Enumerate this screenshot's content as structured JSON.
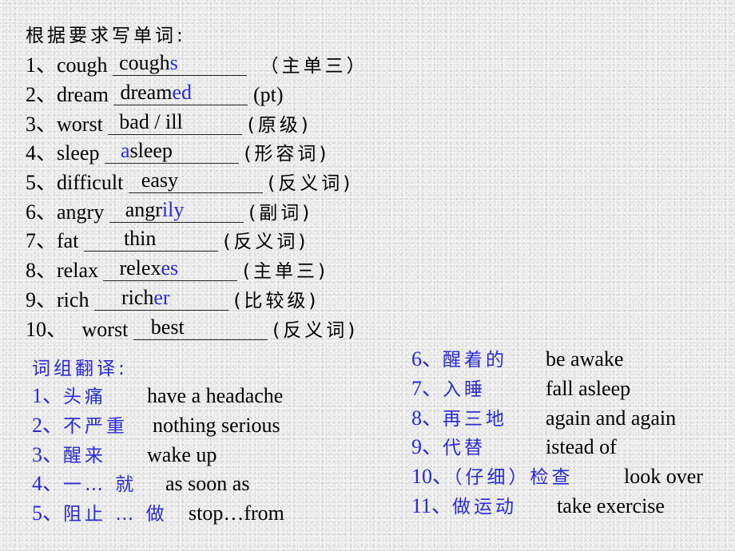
{
  "header": "根据要求写单词:",
  "exercises": [
    {
      "num": "1、",
      "word": "cough",
      "answer_base": "cough",
      "answer_suffix": "s",
      "note": "（主单三）"
    },
    {
      "num": "2、",
      "word": "dream",
      "answer_base": "dream",
      "answer_suffix": "ed",
      "note": "(pt)"
    },
    {
      "num": "3、",
      "word": "worst",
      "answer_base": "bad / ill",
      "answer_suffix": "",
      "note": "(原级)"
    },
    {
      "num": "4、",
      "word": "sleep",
      "answer_prefix": "a",
      "answer_base": "sleep",
      "answer_suffix": "",
      "note": "(形容词)"
    },
    {
      "num": "5、",
      "word": "difficult",
      "answer_base": "easy",
      "answer_suffix": "",
      "note": "(反义词)"
    },
    {
      "num": "6、",
      "word": "angry",
      "answer_base": "angr",
      "answer_suffix": "ily",
      "note": "(副词)"
    },
    {
      "num": "7、",
      "word": "fat",
      "answer_base": "thin",
      "answer_suffix": "",
      "note": "(反义词)"
    },
    {
      "num": "8、",
      "word": "relax",
      "answer_base": "relex",
      "answer_suffix": "es",
      "note": "(主单三)"
    },
    {
      "num": "9、",
      "word": "rich",
      "answer_base": "rich",
      "answer_suffix": "er",
      "note": "(比较级)"
    },
    {
      "num": "10、",
      "word": " worst",
      "answer_base": "best",
      "answer_suffix": "",
      "note": "(反义词)"
    }
  ],
  "phrases_header": "词组翻译:",
  "phrases_left": [
    {
      "num": "1、",
      "cn": "头痛",
      "en": "have a headache"
    },
    {
      "num": "2、",
      "cn": "不严重",
      "en": "nothing serious"
    },
    {
      "num": "3、",
      "cn": "醒来",
      "en": "wake up"
    },
    {
      "num": "4、",
      "cn": "一… 就",
      "en": "as soon as"
    },
    {
      "num": "5、",
      "cn": "阻止 … 做",
      "en": "stop…from"
    }
  ],
  "phrases_right": [
    {
      "num": "6、",
      "cn": "醒着的",
      "en": "be awake"
    },
    {
      "num": "7、",
      "cn": "入睡",
      "en": "fall asleep"
    },
    {
      "num": "8、",
      "cn": "再三地",
      "en": "again and again"
    },
    {
      "num": "9、",
      "cn": "代替",
      "en": "istead of"
    },
    {
      "num": "10、",
      "cn": "（仔细）检查",
      "en": "look over"
    },
    {
      "num": "11、",
      "cn": "做运动",
      "en": "take exercise"
    }
  ],
  "colors": {
    "accent_blue": "#2b2bd6",
    "text": "#000000",
    "background": "#e9e9e9"
  }
}
